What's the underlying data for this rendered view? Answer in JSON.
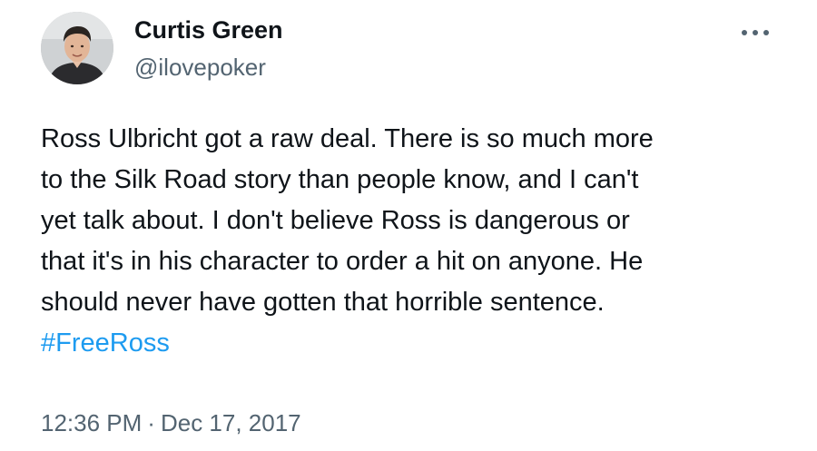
{
  "author": {
    "display_name": "Curtis Green",
    "handle": "@ilovepoker",
    "avatar_icon": "person-photo-icon"
  },
  "menu": {
    "icon": "more-horizontal-icon"
  },
  "tweet": {
    "lines": [
      "Ross Ulbricht got a raw deal. There is so much more",
      "to the Silk Road story than people know, and I can't",
      "yet talk about. I don't believe Ross is dangerous or",
      "that it's in his character to order a hit on anyone. He",
      "should never have gotten that horrible sentence."
    ],
    "hashtag": "#FreeRoss",
    "hashtag_color": "#1d9bf0"
  },
  "meta": {
    "time": "12:36 PM",
    "separator": "·",
    "date": "Dec 17, 2017"
  },
  "colors": {
    "text": "#0f1419",
    "secondary": "#536471",
    "background": "#ffffff"
  }
}
